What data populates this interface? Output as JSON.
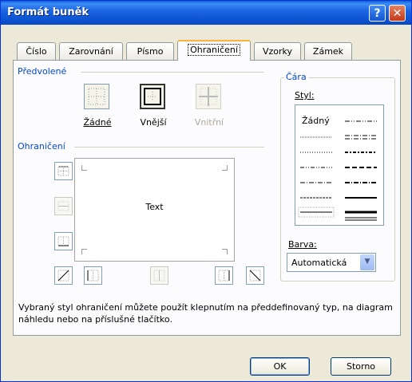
{
  "window": {
    "title": "Formát buněk",
    "help_label": "?",
    "close_label": "✕"
  },
  "tabs": [
    {
      "label": "Číslo"
    },
    {
      "label": "Zarovnání"
    },
    {
      "label": "Písmo"
    },
    {
      "label": "Ohraničení",
      "active": true
    },
    {
      "label": "Vzorky"
    },
    {
      "label": "Zámek"
    }
  ],
  "presets": {
    "title": "Předvolené",
    "none_label": "Žádné",
    "outline_label": "Vnější",
    "inside_label": "Vnitřní"
  },
  "border": {
    "title": "Ohraničení",
    "preview_text": "Text"
  },
  "line": {
    "title": "Čára",
    "style_label": "Styl:",
    "none_label": "Žádný",
    "color_label": "Barva:",
    "color_value": "Automatická"
  },
  "description": "Vybraný styl ohraničení můžete použít klepnutím na předdefinovaný typ, na diagram náhledu nebo na příslušné tlačítko.",
  "buttons": {
    "ok": "OK",
    "cancel": "Storno"
  },
  "colors": {
    "title_bar": "#0b53d0",
    "group_title": "#0046d5",
    "dialog_bg": "#ece9d8"
  }
}
